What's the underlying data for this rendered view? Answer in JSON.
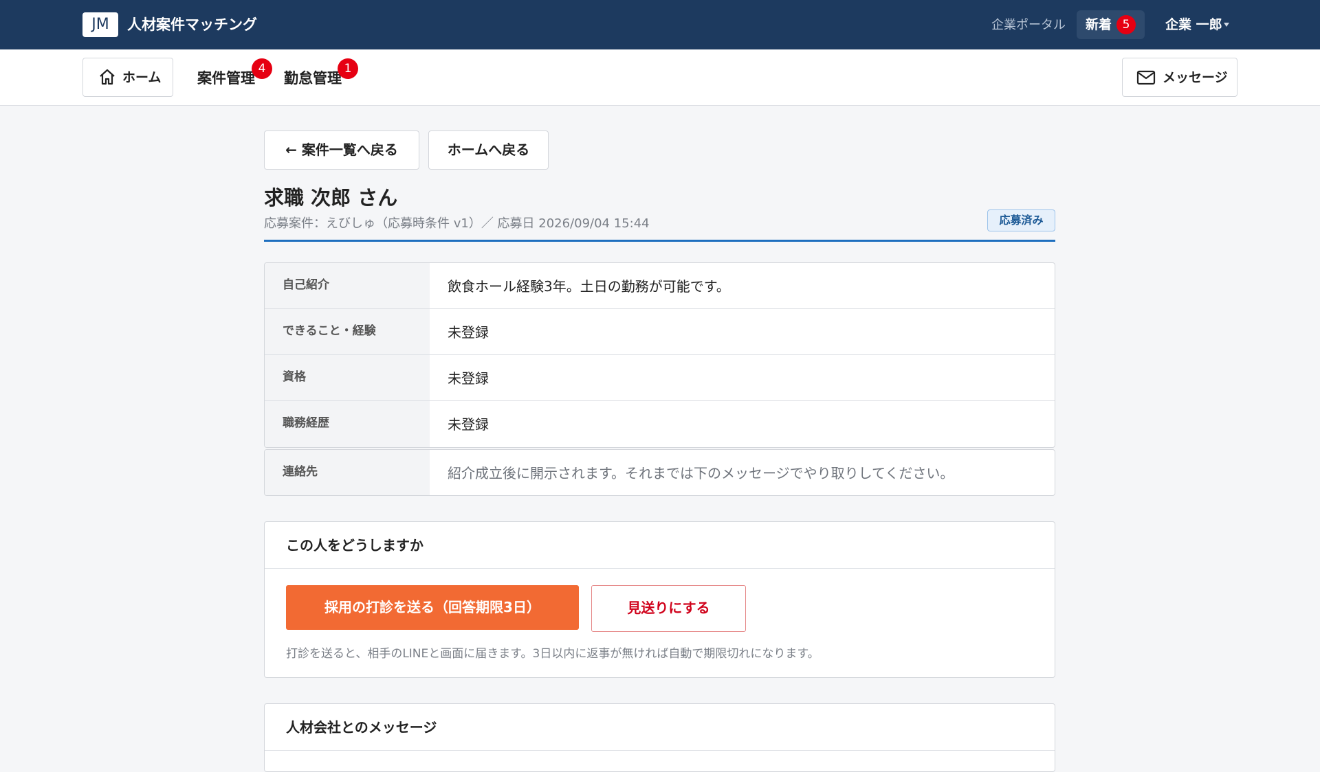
{
  "header": {
    "logo_text": "JM",
    "app_title": "人材案件マッチング",
    "portal_link": "企業ポータル",
    "new_label": "新着",
    "new_count": "5",
    "user_name": "企業 一郎"
  },
  "nav": {
    "home_label": "ホーム",
    "items": [
      {
        "label": "案件管理",
        "badge": "4"
      },
      {
        "label": "勤怠管理",
        "badge": "1"
      }
    ],
    "messages_label": "メッセージ"
  },
  "main": {
    "back_to_list": "← 案件一覧へ戻る",
    "back_to_home": "ホームへ戻る",
    "person_name": "求職 次郎 さん",
    "meta": "応募案件：えびしゅ（応募時条件 v1）／ 応募日 2026/09/04 15:44",
    "status": "応募済み",
    "profile_rows": [
      {
        "key": "自己紹介",
        "value": "飲食ホール経験3年。土日の勤務が可能です。"
      },
      {
        "key": "できること・経験",
        "value": "未登録"
      },
      {
        "key": "資格",
        "value": "未登録"
      },
      {
        "key": "職務経歴",
        "value": "未登録"
      }
    ],
    "contact": {
      "key": "連絡先",
      "value": "紹介成立後に開示されます。それまでは下のメッセージでやり取りしてください。"
    },
    "decision": {
      "title": "この人をどうしますか",
      "offer_button": "採用の打診を送る（回答期限3日）",
      "decline_button": "見送りにする",
      "help": "打診を送ると、相手のLINEと画面に届きます。3日以内に返事が無ければ自動で期限切れになります。"
    },
    "messages_section_title": "人材会社とのメッセージ"
  }
}
